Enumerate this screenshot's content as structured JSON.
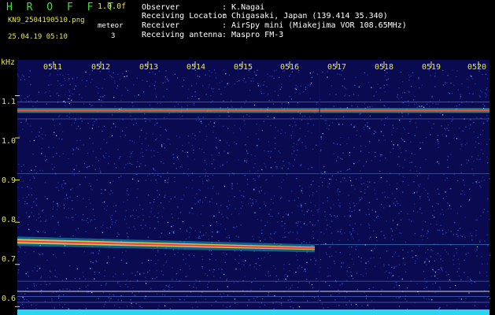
{
  "header": {
    "app_title": "H R O F F T",
    "version": "1.0.0f",
    "filename": "KN9_2504190510.png",
    "datetime": "25.04.19 05:10",
    "meteor_label": "meteor",
    "meteor_count": "3"
  },
  "info": [
    {
      "key": "Observer",
      "value": ": K.Nagai"
    },
    {
      "key": "Receiving Location",
      "value": ": Chigasaki, Japan (139.414 35.340)"
    },
    {
      "key": "Receiver",
      "value": ": AirSpy mini (Miakejima VOR 108.65MHz)"
    },
    {
      "key": "Receiving antenna",
      "value": ": Maspro FM-3"
    }
  ],
  "spectrogram": {
    "unit_label": "kHz",
    "freq_ticks": [
      "1.1",
      "1.0",
      "0.9",
      "0.8",
      "0.7",
      "0.6"
    ],
    "freq_values": [
      1.1,
      1.0,
      0.9,
      0.8,
      0.7,
      0.6
    ],
    "freq_range": [
      0.58,
      1.185
    ],
    "time_ticks": [
      "0511",
      "0512",
      "0513",
      "0514",
      "0515",
      "0516",
      "0517",
      "0518",
      "0519",
      "0520"
    ],
    "time_range_minutes": [
      0,
      10
    ],
    "carrier_khz": 1.065,
    "echo_khz_start": 0.755,
    "echo_khz_end": 0.738,
    "echo_end_minute": 6.3,
    "colors": {
      "background": "#0a0a50",
      "noise": "#3a4fd0",
      "carrier": "#ff4a4a",
      "echo": "#ff3355",
      "label": "#e8e84a",
      "title": "#39e639"
    }
  }
}
